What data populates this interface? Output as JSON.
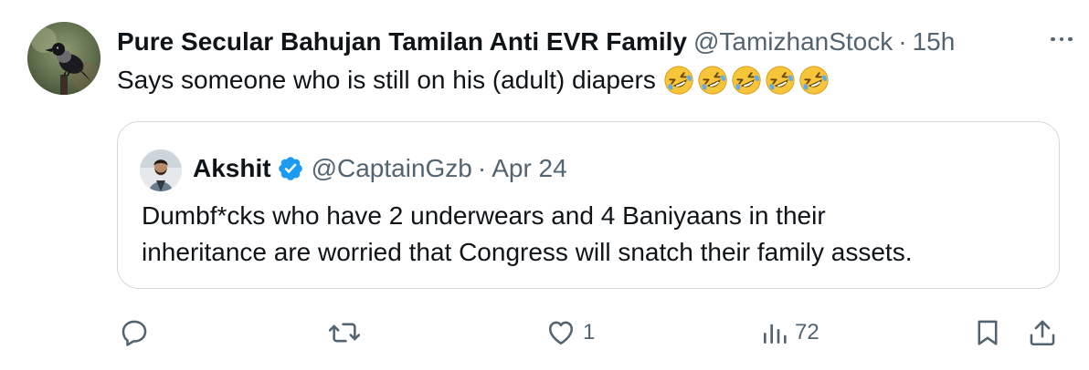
{
  "tweet": {
    "author": {
      "display_name": "Pure Secular Bahujan Tamilan Anti EVR Family",
      "handle": "@TamizhanStock",
      "time": "15h",
      "separator": "·"
    },
    "text": "Says someone who is still on his (adult) diapers",
    "emojis": [
      "rolling-on-floor-laughing",
      "rolling-on-floor-laughing",
      "rolling-on-floor-laughing",
      "rolling-on-floor-laughing",
      "rolling-on-floor-laughing"
    ]
  },
  "quote": {
    "author": {
      "display_name": "Akshit",
      "verified": true,
      "handle": "@CaptainGzb",
      "separator": "·",
      "date": "Apr 24"
    },
    "text_lines": [
      "Dumbf*cks who have 2 underwears and 4 Baniyaans in their",
      "inheritance are worried that Congress will snatch their family assets."
    ]
  },
  "actions": {
    "reply": {
      "icon": "reply-icon",
      "count": ""
    },
    "repost": {
      "icon": "repost-icon",
      "count": ""
    },
    "like": {
      "icon": "heart-icon",
      "count": "1"
    },
    "views": {
      "icon": "views-icon",
      "count": "72"
    },
    "bookmark": {
      "icon": "bookmark-icon"
    },
    "share": {
      "icon": "share-icon"
    }
  },
  "colors": {
    "text_primary": "#0f1419",
    "text_secondary": "#536471",
    "border": "#cfd9de",
    "verified_blue": "#1d9bf0",
    "emoji_yellow": "#f7c53a"
  }
}
